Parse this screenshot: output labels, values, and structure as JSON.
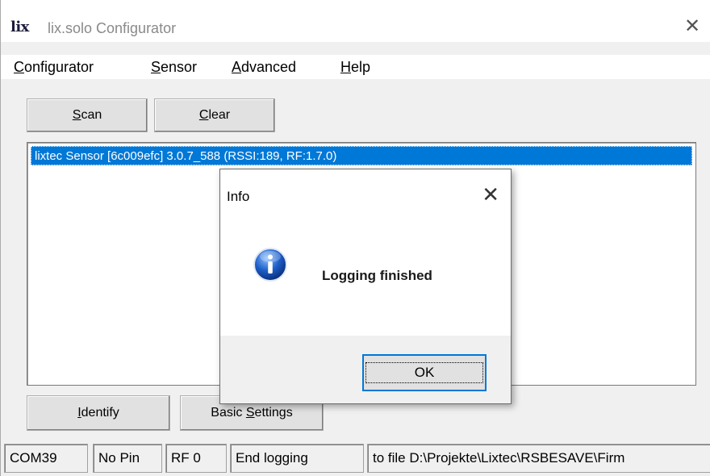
{
  "window": {
    "logo": "lix",
    "title": "lix.solo Configurator",
    "close_glyph": "✕"
  },
  "menu": [
    {
      "label": "Configurator",
      "accel": "C",
      "rest": "onfigurator"
    },
    {
      "label": "Sensor",
      "accel": "S",
      "rest": "ensor"
    },
    {
      "label": "Advanced",
      "accel": "A",
      "rest": "dvanced"
    },
    {
      "label": "Help",
      "accel": "H",
      "rest": "elp"
    }
  ],
  "toolbar": {
    "scan": {
      "accel": "S",
      "rest": "can"
    },
    "clear": {
      "accel": "C",
      "rest": "lear"
    }
  },
  "devices": [
    "lixtec Sensor [6c009efc] 3.0.7_588 (RSSI:189, RF:1.7.0)"
  ],
  "bottom_buttons": {
    "identify": {
      "accel": "I",
      "rest": "dentify"
    },
    "basic_settings": {
      "pre": "Basic ",
      "accel": "S",
      "rest": "ettings"
    }
  },
  "status": {
    "port": "COM39",
    "pin": "No Pin",
    "rf": "RF 0",
    "action": "End logging",
    "message": "to file D:\\Projekte\\Lixtec\\RSBESAVE\\Firm"
  },
  "dialog": {
    "title": "Info",
    "close_glyph": "✕",
    "message": "Logging finished",
    "ok_label": "OK",
    "icon": "info-icon"
  },
  "colors": {
    "selection": "#0078d7",
    "window_bg": "#f0f0f0",
    "focus_border": "#0078d7"
  }
}
